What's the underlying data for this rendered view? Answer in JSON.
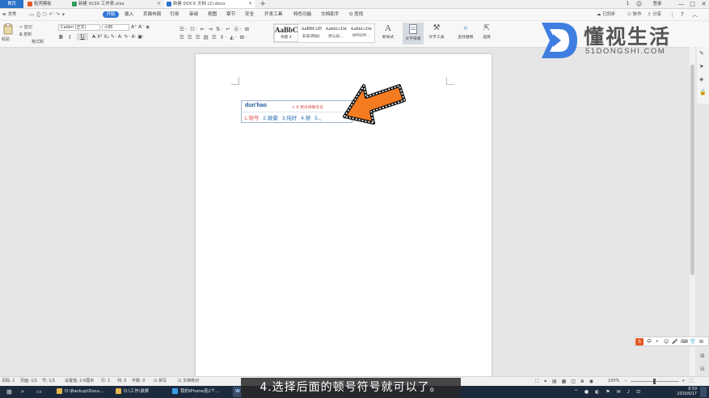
{
  "tabs": {
    "home": "首页",
    "docer": "稻壳模板",
    "xlsx": "新建 XLSX 工作表.xlsx",
    "docx": "新建 DOCX 文档 (2).docx",
    "plus": "+"
  },
  "window": {
    "badge": "1",
    "avatar_label": "登录",
    "min": "—",
    "max": "□",
    "close": "✕"
  },
  "menu": {
    "file": "≡ 文件",
    "start": "开始",
    "insert": "插入",
    "layout": "页面布局",
    "reference": "引用",
    "review": "审阅",
    "view": "视图",
    "section": "章节",
    "security": "安全",
    "developer": "开发工具",
    "special": "特色功能",
    "doc_assistant": "文档助手",
    "search": "Q 查找",
    "sync": "已同步",
    "collab": "协作",
    "share": "分享"
  },
  "ribbon": {
    "paste": "粘贴",
    "cut": "剪切",
    "copy": "复制",
    "format_painter": "格式刷",
    "font_name": "Calibri (正文)",
    "font_size": "小四",
    "bold": "B",
    "italic": "I",
    "underline": "U",
    "styles": [
      {
        "sample": "AaBbC",
        "label": "标题 4"
      },
      {
        "sample": "AaBbCcD",
        "label": "非表(网站)"
      },
      {
        "sample": "AaBbCcDd",
        "label": "默认段..."
      },
      {
        "sample": "AaBbCcDd",
        "label": "WPSOff..."
      }
    ],
    "new_style": "新样式",
    "text_layout": "文字排版",
    "text_tools": "文字工具",
    "find_replace": "查找替换",
    "select": "选择"
  },
  "logo": {
    "title": "懂视生活",
    "url": "51DONGSHI.COM"
  },
  "ime": {
    "input": "dun'hao",
    "tip": "⊙ 6 更多特殊符号",
    "candidates": [
      "1.顿号",
      "2.敦豪",
      "3.炖好",
      "4.顿",
      "5.、"
    ]
  },
  "ime_bar": {
    "lang": "中",
    "items": [
      "•",
      "☺",
      "🎤",
      "⌨",
      "👕",
      "⊞"
    ]
  },
  "status": {
    "pages": "页码: 1",
    "page_of": "页面: 1/1",
    "section": "节: 1/1",
    "setting": "设置值: 2.6厘米",
    "row": "行: 1",
    "col": "列: 0",
    "words": "字数: 0",
    "spell": "拼写",
    "compat": "文档校对",
    "zoom": "100%"
  },
  "subtitle": "4.选择后面的顿号符号就可以了。",
  "taskbar": {
    "item1": "D:\\Backup\\Docu...",
    "item2": "D:\\工作\\录屏",
    "item3": "我的iPhone连2个...",
    "item4": "W",
    "time": "8:59",
    "date": "2020/6/17"
  },
  "colors": {
    "accent": "#3276d9",
    "arrow": "#f47b20",
    "cand_first": "#d9534f",
    "cand": "#2a6fb3"
  }
}
